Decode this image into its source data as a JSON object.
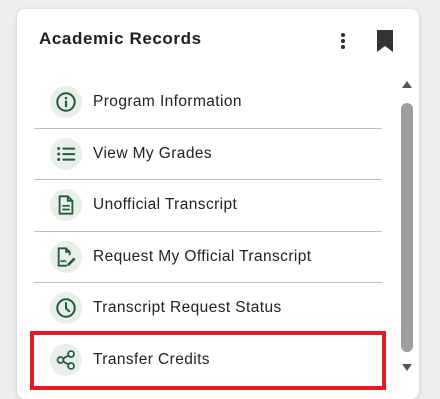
{
  "card": {
    "title": "Academic Records"
  },
  "colors": {
    "accent_green": "#1e5e3a",
    "highlight_red": "#e31b23",
    "icon_bg": "#e8efe8"
  },
  "items": [
    {
      "label": "Program Information",
      "icon": "info-icon"
    },
    {
      "label": "View My Grades",
      "icon": "list-icon"
    },
    {
      "label": "Unofficial Transcript",
      "icon": "document-icon"
    },
    {
      "label": "Request My Official Transcript",
      "icon": "signed-document-icon"
    },
    {
      "label": "Transcript Request Status",
      "icon": "clock-icon"
    },
    {
      "label": "Transfer Credits",
      "icon": "share-icon"
    }
  ]
}
